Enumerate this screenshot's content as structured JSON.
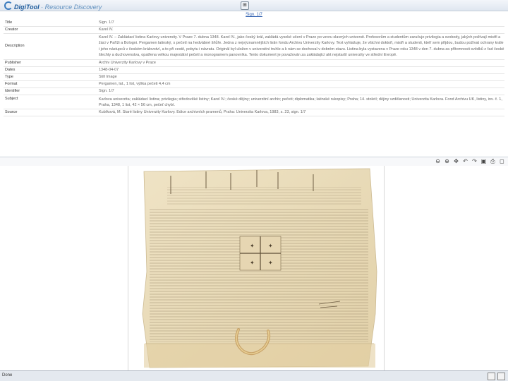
{
  "header": {
    "brand": "DigiTool",
    "sub": " · Resource Discovery",
    "top_icon": "⊞",
    "nav_link": "Sign. 1/7"
  },
  "record": {
    "title_label": "Title",
    "title_value": "Sign. 1/7",
    "creator_label": "Creator",
    "creator_value": "Karel IV.",
    "description_label": "Description",
    "description_value": "Karel IV. – Zakládací listina Karlovy university. V Praze 7. dubna 1348. Karel IV., jako český král, zakládá vysoké učení v Praze po vzoru slavných universit. Profesorům a studentům zaručuje privilegia a svobody, jakých požívají mistři a žáci v Paříži a Bologni. Pergamen latinský, s pečetí na hedvábné šňůře. Jedna z nejvýznamnějších listin fondu Archivu Univerzity Karlovy. Text vyhlašuje, že všichni doktoři, mistři a studenti, kteří sem přijdou, budou požívat ochrany krále i jeho nástupců v českém království, a to při cestě, pobytu i návratu. Originál byl uložen v universitní truhle a k nám se dochoval v dobrém stavu. Listina byla vystavena v Praze roku 1348 v den 7. dubna za přítomnosti svědků z řad české šlechty a duchovenstva, opatřena velkou majestátní pečetí a monogramem panovníka. Tento dokument je považován za zakládající akt nejstarší univerzity ve střední Evropě."
  },
  "record_rows": [
    {
      "label": "Publisher",
      "value": "Archiv Univerzity Karlovy v Praze"
    },
    {
      "label": "Dates",
      "value": "1348-04-07"
    },
    {
      "label": "Type",
      "value": "Still Image"
    },
    {
      "label": "Format",
      "value": "Pergamen, lat., 1 list, výška pečeti 4,4 cm"
    },
    {
      "label": "Identifier",
      "value": "Sign. 1/7"
    }
  ],
  "record_extra": {
    "subject_label": "Subject",
    "subject_value": "Karlova univerzita; zakládací listina; privilegia; středověké listiny; Karel IV.; české dějiny; univerzitní archiv; pečeti; diplomatika; latinské rukopisy; Praha; 14. století; dějiny vzdělanosti; Univerzita Karlova. Fond Archivu UK, listiny, inv. č. 1, Praha, 1348, 1 list, 42 × 56 cm, pečeť chybí.",
    "source_label": "Source",
    "source_value": "Kubíková, M. Staré listiny Univerzity Karlovy. Edice archivních pramenů, Praha: Univerzita Karlova, 1983, s. 23, sign. 1/7"
  },
  "statusbar": {
    "left": "Done"
  },
  "colors": {
    "brand": "#1c5a9c",
    "parchment": "#ede1c1",
    "seal_cord": "#c9a46a"
  }
}
